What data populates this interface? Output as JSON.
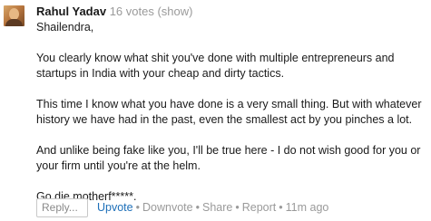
{
  "answer": {
    "author": "Rahul Yadav",
    "votes_text": "16 votes (show)",
    "paragraphs": [
      "Shailendra,",
      "You clearly know what shit you've done with multiple entrepreneurs and startups in India with your cheap and dirty tactics.",
      "This time I know what you have done is a very small thing. But with whatever history we have had in the past, even the smallest act by you pinches a lot.",
      "And unlike being fake like you, I'll be true here - I do not wish good for you or your firm until you're at the helm.",
      "Go die motherf*****."
    ]
  },
  "actions": {
    "reply_placeholder": "Reply...",
    "upvote": "Upvote",
    "downvote": "Downvote",
    "share": "Share",
    "report": "Report",
    "time_ago": "11m ago",
    "separator": "•"
  }
}
